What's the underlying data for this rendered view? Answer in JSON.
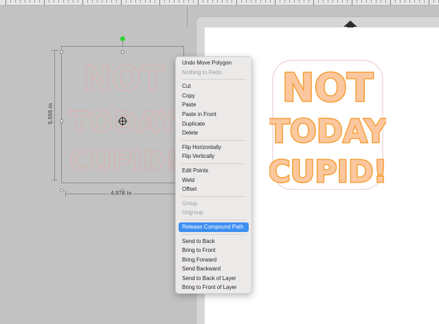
{
  "canvas": {
    "width_dim": "4.978 in",
    "height_dim": "5.555 in"
  },
  "design": {
    "words": [
      "NOT",
      "TODAY",
      "CUPID!"
    ],
    "fill_color": "#fbc79e",
    "outline_color": "#f59e34",
    "selected_outline_color": "#e8a6a6"
  },
  "menu": {
    "items": [
      {
        "label": "Undo Move Polygon",
        "state": "enabled"
      },
      {
        "label": "Nothing to Redo",
        "state": "disabled"
      },
      {
        "separator": true
      },
      {
        "label": "Cut",
        "state": "enabled"
      },
      {
        "label": "Copy",
        "state": "enabled"
      },
      {
        "label": "Paste",
        "state": "enabled"
      },
      {
        "label": "Paste in Front",
        "state": "enabled"
      },
      {
        "label": "Duplicate",
        "state": "enabled"
      },
      {
        "label": "Delete",
        "state": "enabled"
      },
      {
        "separator": true
      },
      {
        "label": "Flip Horizontally",
        "state": "enabled"
      },
      {
        "label": "Flip Vertically",
        "state": "enabled"
      },
      {
        "separator": true
      },
      {
        "label": "Edit Points",
        "state": "enabled"
      },
      {
        "label": "Weld",
        "state": "enabled"
      },
      {
        "label": "Offset",
        "state": "enabled"
      },
      {
        "separator": true
      },
      {
        "label": "Group",
        "state": "disabled"
      },
      {
        "label": "Ungroup",
        "state": "disabled"
      },
      {
        "separator": true
      },
      {
        "label": "Release Compound Path",
        "state": "highlighted"
      },
      {
        "separator": true
      },
      {
        "label": "Send to Back",
        "state": "enabled"
      },
      {
        "label": "Bring to Front",
        "state": "enabled"
      },
      {
        "label": "Bring Forward",
        "state": "enabled"
      },
      {
        "label": "Send Backward",
        "state": "enabled"
      },
      {
        "label": "Send to Back of Layer",
        "state": "enabled"
      },
      {
        "label": "Bring to Front of Layer",
        "state": "enabled"
      }
    ]
  },
  "icons": {
    "mat_arrow": "up-arrow-icon",
    "center": "crosshair-icon",
    "rotate": "rotate-handle-icon"
  }
}
